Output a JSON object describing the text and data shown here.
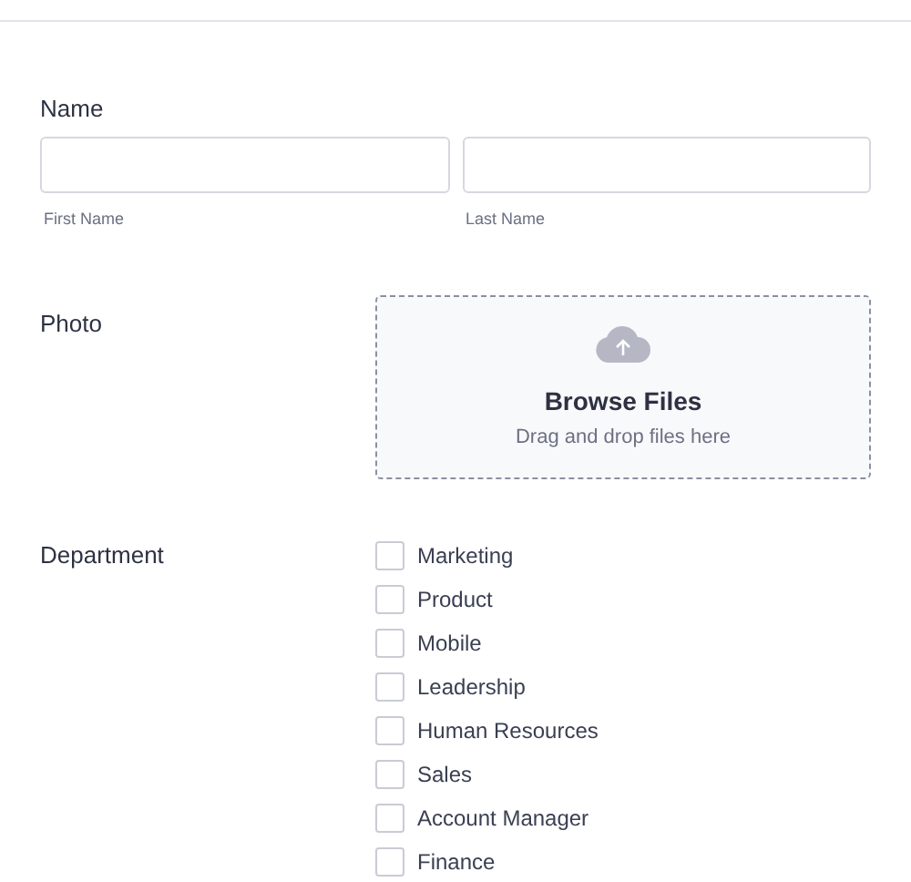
{
  "name": {
    "label": "Name",
    "fields": [
      {
        "sublabel": "First Name"
      },
      {
        "sublabel": "Last Name"
      }
    ]
  },
  "photo": {
    "label": "Photo",
    "title": "Browse Files",
    "hint": "Drag and drop files here"
  },
  "department": {
    "label": "Department",
    "options": [
      {
        "label": "Marketing",
        "checked": false
      },
      {
        "label": "Product",
        "checked": false
      },
      {
        "label": "Mobile",
        "checked": false
      },
      {
        "label": "Leadership",
        "checked": false
      },
      {
        "label": "Human Resources",
        "checked": false
      },
      {
        "label": "Sales",
        "checked": false
      },
      {
        "label": "Account Manager",
        "checked": false
      },
      {
        "label": "Finance",
        "checked": false
      }
    ]
  }
}
